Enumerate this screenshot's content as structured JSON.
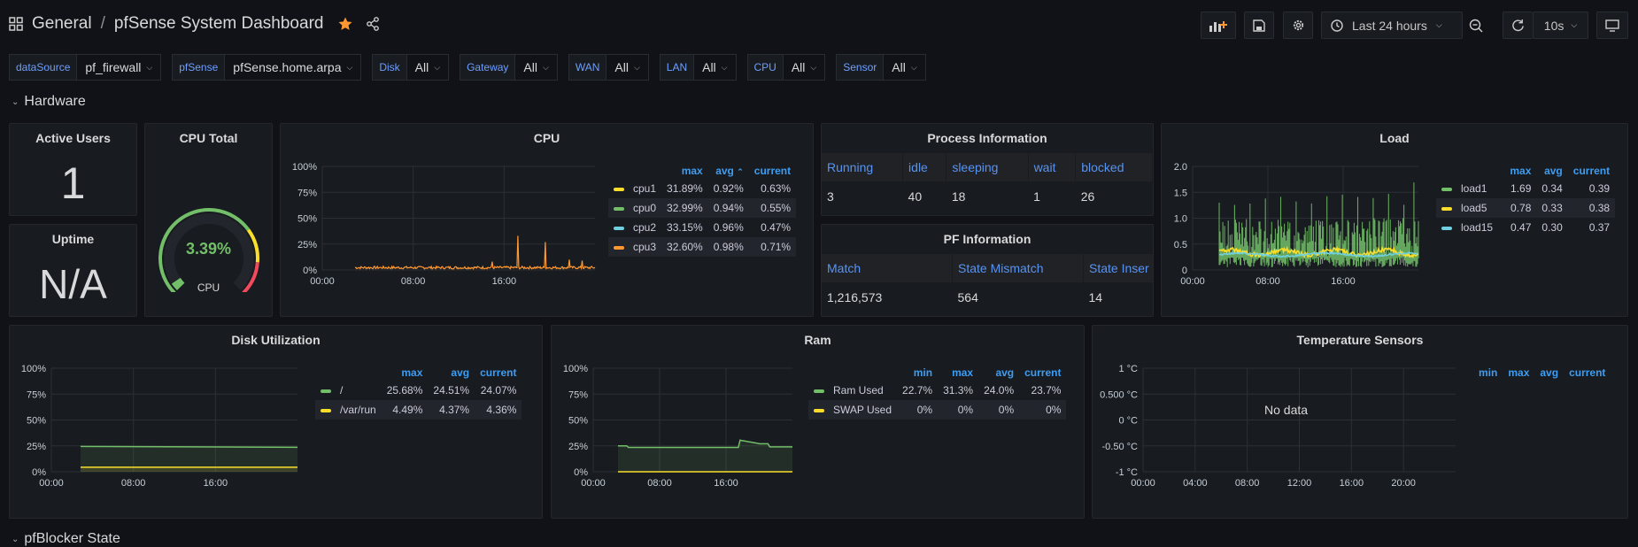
{
  "breadcrumb": {
    "folder": "General",
    "separator": "/",
    "title": "pfSense System Dashboard"
  },
  "toolbar": {
    "time_range": "Last 24 hours",
    "refresh_interval": "10s"
  },
  "variables": [
    {
      "label": "dataSource",
      "value": "pf_firewall"
    },
    {
      "label": "pfSense",
      "value": "pfSense.home.arpa"
    },
    {
      "label": "Disk",
      "value": "All"
    },
    {
      "label": "Gateway",
      "value": "All"
    },
    {
      "label": "WAN",
      "value": "All"
    },
    {
      "label": "LAN",
      "value": "All"
    },
    {
      "label": "CPU",
      "value": "All"
    },
    {
      "label": "Sensor",
      "value": "All"
    }
  ],
  "rows": {
    "hardware": "Hardware",
    "pfblocker": "pfBlocker State"
  },
  "active_users": {
    "title": "Active Users",
    "value": "1"
  },
  "uptime": {
    "title": "Uptime",
    "value": "N/A"
  },
  "cpu_total": {
    "title": "CPU Total",
    "value": "3.39%",
    "label": "CPU",
    "fraction": 0.0339
  },
  "colors": {
    "green": "#73bf69",
    "yellow": "#fade2a",
    "cyan": "#8ab8ff",
    "orange": "#ff9830",
    "blue": "#3d9df3"
  },
  "cpu_panel": {
    "title": "CPU",
    "legend_headers": [
      "max",
      "avg",
      "current"
    ],
    "series": [
      {
        "name": "cpu1",
        "color": "#fade2a",
        "max": "31.89%",
        "avg": "0.92%",
        "current": "0.63%"
      },
      {
        "name": "cpu0",
        "color": "#73bf69",
        "max": "32.99%",
        "avg": "0.94%",
        "current": "0.55%"
      },
      {
        "name": "cpu2",
        "color": "#6ed0e0",
        "max": "33.15%",
        "avg": "0.96%",
        "current": "0.47%"
      },
      {
        "name": "cpu3",
        "color": "#ff9830",
        "max": "32.60%",
        "avg": "0.98%",
        "current": "0.71%"
      }
    ],
    "y_ticks": [
      "100%",
      "75%",
      "50%",
      "25%",
      "0%"
    ],
    "x_ticks": [
      "00:00",
      "08:00",
      "16:00"
    ]
  },
  "process_info": {
    "title": "Process Information",
    "headers": [
      "Running",
      "idle",
      "sleeping",
      "wait",
      "blocked"
    ],
    "values": [
      "3",
      "40",
      "18",
      "1",
      "26"
    ]
  },
  "pf_info": {
    "title": "PF Information",
    "headers": [
      "Match",
      "State Mismatch",
      "State Inser"
    ],
    "values": [
      "1,216,573",
      "564",
      "14"
    ]
  },
  "load_panel": {
    "title": "Load",
    "legend_headers": [
      "max",
      "avg",
      "current"
    ],
    "series": [
      {
        "name": "load1",
        "color": "#73bf69",
        "max": "1.69",
        "avg": "0.34",
        "current": "0.39"
      },
      {
        "name": "load5",
        "color": "#fade2a",
        "max": "0.78",
        "avg": "0.33",
        "current": "0.38"
      },
      {
        "name": "load15",
        "color": "#6ed0e0",
        "max": "0.47",
        "avg": "0.30",
        "current": "0.37"
      }
    ],
    "y_ticks": [
      "2.0",
      "1.5",
      "1.0",
      "0.5",
      "0"
    ],
    "x_ticks": [
      "00:00",
      "08:00",
      "16:00"
    ]
  },
  "disk_panel": {
    "title": "Disk Utilization",
    "legend_headers": [
      "max",
      "avg",
      "current"
    ],
    "series": [
      {
        "name": "/",
        "color": "#73bf69",
        "max": "25.68%",
        "avg": "24.51%",
        "current": "24.07%"
      },
      {
        "name": "/var/run",
        "color": "#fade2a",
        "max": "4.49%",
        "avg": "4.37%",
        "current": "4.36%"
      }
    ],
    "y_ticks": [
      "100%",
      "75%",
      "50%",
      "25%",
      "0%"
    ],
    "x_ticks": [
      "00:00",
      "08:00",
      "16:00"
    ]
  },
  "ram_panel": {
    "title": "Ram",
    "legend_headers": [
      "min",
      "max",
      "avg",
      "current"
    ],
    "series": [
      {
        "name": "Ram Used",
        "color": "#73bf69",
        "min": "22.7%",
        "max": "31.3%",
        "avg": "24.0%",
        "current": "23.7%"
      },
      {
        "name": "SWAP Used",
        "color": "#fade2a",
        "min": "0%",
        "max": "0%",
        "avg": "0%",
        "current": "0%"
      }
    ],
    "y_ticks": [
      "100%",
      "75%",
      "50%",
      "25%",
      "0%"
    ],
    "x_ticks": [
      "00:00",
      "08:00",
      "16:00"
    ]
  },
  "temp_panel": {
    "title": "Temperature Sensors",
    "legend_headers": [
      "min",
      "max",
      "avg",
      "current"
    ],
    "no_data": "No data",
    "y_ticks": [
      "1 °C",
      "0.500 °C",
      "0 °C",
      "-0.50 °C",
      "-1 °C"
    ],
    "x_ticks": [
      "00:00",
      "04:00",
      "08:00",
      "12:00",
      "16:00",
      "20:00"
    ]
  }
}
